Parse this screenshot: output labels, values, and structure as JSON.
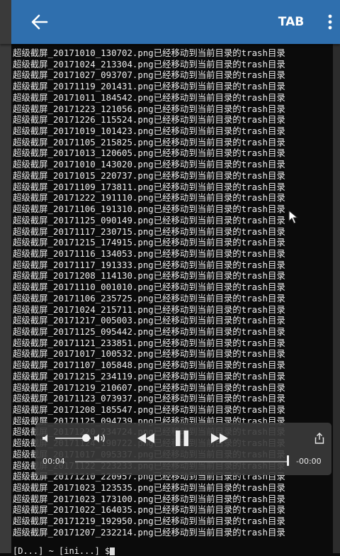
{
  "app_bar": {
    "back_icon": "arrow-left-icon",
    "tab_label": "TAB",
    "overflow_icon": "more-vertical-icon",
    "color": "#2f6fae"
  },
  "terminal": {
    "lines": [
      "超级截屏_20171010_130702.png已经移动到当前目录的trash目录",
      "超级截屏_20171024_213304.png已经移动到当前目录的trash目录",
      "超级截屏_20171027_093707.png已经移动到当前目录的trash目录",
      "超级截屏_20171119_201431.png已经移动到当前目录的trash目录",
      "超级截屏_20171011_184542.png已经移动到当前目录的trash目录",
      "超级截屏_20171223_121056.png已经移动到当前目录的trash目录",
      "超级截屏_20171226_115524.png已经移动到当前目录的trash目录",
      "超级截屏_20171019_101423.png已经移动到当前目录的trash目录",
      "超级截屏_20171105_215825.png已经移动到当前目录的trash目录",
      "超级截屏_20171013_120605.png已经移动到当前目录的trash目录",
      "超级截屏_20171010_143020.png已经移动到当前目录的trash目录",
      "超级截屏_20171015_220737.png已经移动到当前目录的trash目录",
      "超级截屏_20171109_173811.png已经移动到当前目录的trash目录",
      "超级截屏_20171222_191110.png已经移动到当前目录的trash目录",
      "超级截屏_20171106_191310.png已经移动到当前目录的trash目录",
      "超级截屏_20171125_090149.png已经移动到当前目录的trash目录",
      "超级截屏_20171117_230715.png已经移动到当前目录的trash目录",
      "超级截屏_20171215_174915.png已经移动到当前目录的trash目录",
      "超级截屏_20171116_134053.png已经移动到当前目录的trash目录",
      "超级截屏_20171117_191333.png已经移动到当前目录的trash目录",
      "超级截屏_20171208_114130.png已经移动到当前目录的trash目录",
      "超级截屏_20171110_001010.png已经移动到当前目录的trash目录",
      "超级截屏_20171106_235725.png已经移动到当前目录的trash目录",
      "超级截屏_20171024_215711.png已经移动到当前目录的trash目录",
      "超级截屏_20171217_005003.png已经移动到当前目录的trash目录",
      "超级截屏_20171125_095442.png已经移动到当前目录的trash目录",
      "超级截屏_20171121_233851.png已经移动到当前目录的trash目录",
      "超级截屏_20171017_100532.png已经移动到当前目录的trash目录",
      "超级截屏_20171107_105848.png已经移动到当前目录的trash目录",
      "超级截屏_20171215_234119.png已经移动到当前目录的trash目录",
      "超级截屏_20171219_210607.png已经移动到当前目录的trash目录",
      "超级截屏_20171123_073937.png已经移动到当前目录的trash目录",
      "超级截屏_20171208_185547.png已经移动到当前目录的trash目录",
      "超级截屏_20171125_094739.png已经移动到当前目录的trash目录",
      "超级截屏_20171220_234724.png已经移动到当前目录的trash目录",
      "超级截屏_20171124_190722.png已经移动到当前目录的trash目录",
      "超级截屏_20171017_095337.png已经移动到当前目录的trash目录",
      "超级截屏_20171122_223233.png已经移动到当前目录的trash目录",
      "超级截屏_20171210_220957.png已经移动到当前目录的trash目录",
      "超级截屏_20171023_123535.png已经移动到当前目录的trash目录",
      "超级截屏_20171023_173100.png已经移动到当前目录的trash目录",
      "超级截屏_20171022_164035.png已经移动到当前目录的trash目录",
      "超级截屏_20171219_192950.png已经移动到当前目录的trash目录",
      "超级截屏_20171207_232214.png已经移动到当前目录的trash目录"
    ],
    "prompt": "[D...] ~ [ini...] $"
  },
  "player": {
    "volume_icon": "volume-low-icon",
    "volume_high_icon": "volume-high-icon",
    "volume_level": 0.75,
    "rewind_icon": "rewind-icon",
    "pause_icon": "pause-icon",
    "forward_icon": "fast-forward-icon",
    "share_icon": "share-icon",
    "current_time": "00:04",
    "remaining_time": "-00:00",
    "progress": 1.0
  }
}
